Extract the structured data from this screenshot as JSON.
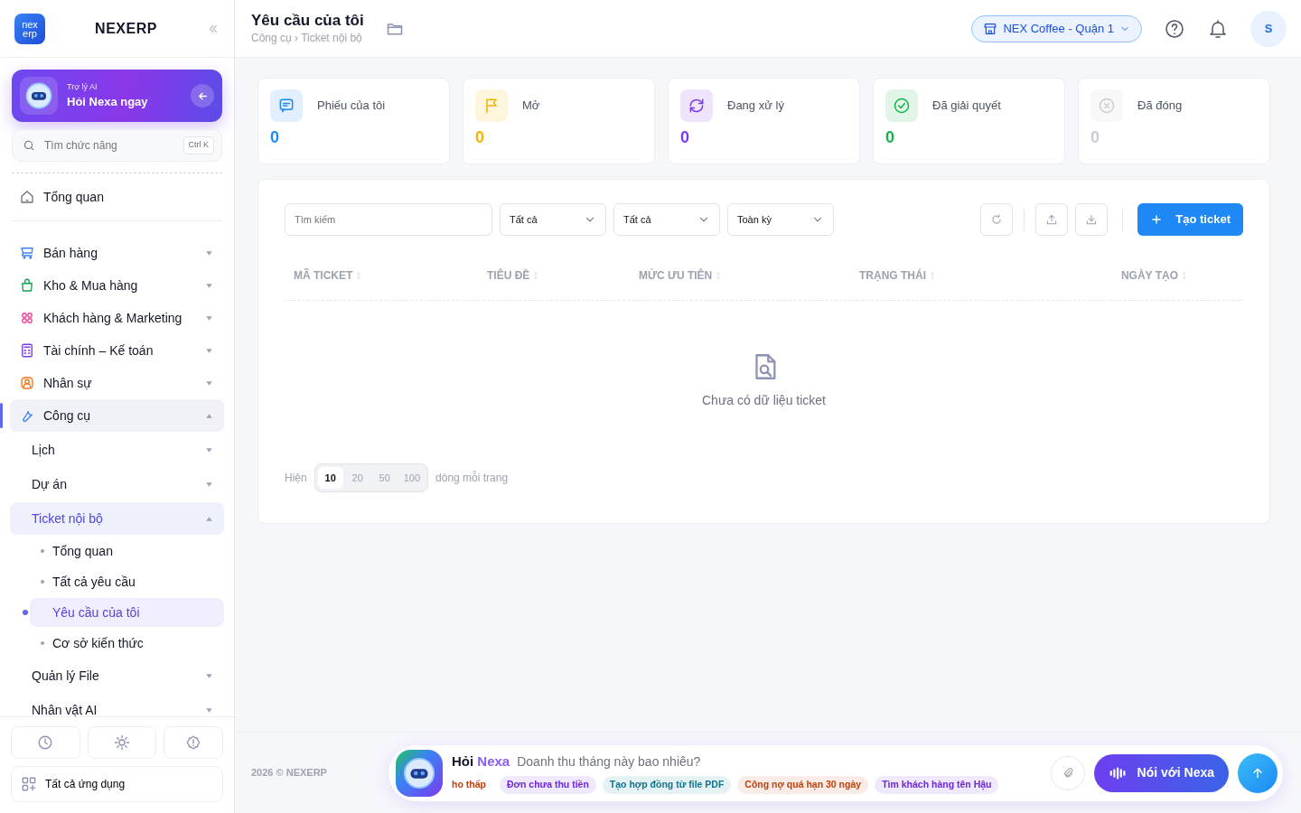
{
  "sidebar": {
    "logo_text": [
      "nex",
      "erp"
    ],
    "brand": "NEXERP",
    "ai_card": {
      "caption": "Trợ lý AI",
      "title": "Hỏi Nexa ngay"
    },
    "search": {
      "placeholder": "Tìm chức năng",
      "shortcut": "Ctrl K"
    },
    "nav": [
      {
        "label": "Tổng quan",
        "kind": "single",
        "selected": false
      },
      {
        "label": "Bán hàng",
        "kind": "group",
        "expanded": false,
        "selected": false
      },
      {
        "label": "Kho & Mua hàng",
        "kind": "group",
        "expanded": false,
        "selected": false
      },
      {
        "label": "Khách hàng & Marketing",
        "kind": "group",
        "expanded": false,
        "selected": false
      },
      {
        "label": "Tài chính – Kế toán",
        "kind": "group",
        "expanded": false,
        "selected": false
      },
      {
        "label": "Nhân sự",
        "kind": "group",
        "expanded": false,
        "selected": false
      },
      {
        "label": "Công cụ",
        "kind": "group",
        "expanded": true,
        "selected": true,
        "children": [
          {
            "label": "Lịch",
            "expanded": false,
            "selected": false
          },
          {
            "label": "Dự án",
            "expanded": false,
            "selected": false
          },
          {
            "label": "Ticket nội bộ",
            "expanded": true,
            "selected": true,
            "children": [
              {
                "label": "Tổng quan",
                "selected": false
              },
              {
                "label": "Tất cả yêu cầu",
                "selected": false
              },
              {
                "label": "Yêu cầu của tôi",
                "selected": true
              },
              {
                "label": "Cơ sở kiến thức",
                "selected": false
              }
            ]
          },
          {
            "label": "Quản lý File",
            "expanded": false,
            "selected": false
          },
          {
            "label": "Nhân vật AI",
            "expanded": false,
            "selected": false
          }
        ]
      }
    ],
    "all_apps": "Tất cả ứng dụng"
  },
  "header": {
    "title": "Yêu cầu của tôi",
    "breadcrumb": "Công cụ › Ticket nội bộ",
    "branch": "NEX Coffee - Quận 1",
    "avatar": "S"
  },
  "stats": [
    {
      "label": "Phiếu của tôi",
      "value": "0",
      "color": "#1e88f5"
    },
    {
      "label": "Mở",
      "value": "0",
      "color": "#f5b400"
    },
    {
      "label": "Đang xử lý",
      "value": "0",
      "color": "#7c3aed"
    },
    {
      "label": "Đã giải quyết",
      "value": "0",
      "color": "#16b34a"
    },
    {
      "label": "Đã đóng",
      "value": "0",
      "color": "#c9ccd3"
    }
  ],
  "filters": {
    "search_placeholder": "Tìm kiếm",
    "selects": [
      "Tất cả",
      "Tất cả",
      "Toàn kỳ"
    ],
    "create_button": "Tạo ticket"
  },
  "table": {
    "columns": [
      "MÃ TICKET",
      "TIÊU ĐỀ",
      "MỨC ƯU TIÊN",
      "TRẠNG THÁI",
      "NGÀY TẠO"
    ],
    "empty_text": "Chưa có dữ liệu ticket"
  },
  "pagination": {
    "prefix": "Hiện",
    "sizes": [
      {
        "label": "10",
        "selected": true
      },
      {
        "label": "20",
        "selected": false
      },
      {
        "label": "50",
        "selected": false
      },
      {
        "label": "100",
        "selected": false
      }
    ],
    "suffix": "dòng mỗi trang"
  },
  "footer": {
    "copyright": "2026 © NEXERP"
  },
  "assistant": {
    "title_prefix": "Hỏi",
    "title_name": "Nexa",
    "placeholder": "Doanh thu tháng này bao nhiêu?",
    "suggestions": [
      {
        "label": "ho thấp",
        "color": "#c2410c"
      },
      {
        "label": "Đơn chưa thu tiền",
        "color": "#6d28d9"
      },
      {
        "label": "Tạo hợp đồng từ file PDF",
        "color": "#0e7490"
      },
      {
        "label": "Công nợ quá hạn 30 ngày",
        "color": "#c2410c"
      },
      {
        "label": "Tìm khách hàng tên Hậu",
        "color": "#6d28d9"
      }
    ],
    "voice_button": "Nói với Nexa"
  }
}
